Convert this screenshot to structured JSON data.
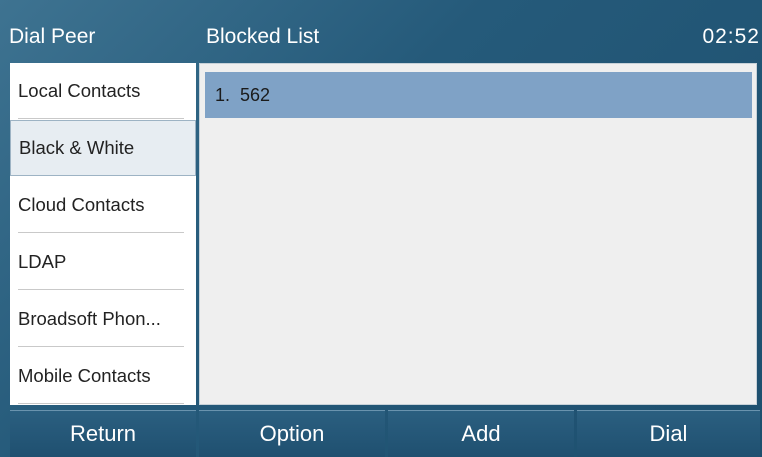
{
  "header": {
    "left_title": "Dial Peer",
    "center_title": "Blocked List",
    "clock": "02:52"
  },
  "sidebar": {
    "items": [
      {
        "label": "Local Contacts",
        "selected": false
      },
      {
        "label": "Black & White",
        "selected": true
      },
      {
        "label": "Cloud Contacts",
        "selected": false
      },
      {
        "label": "LDAP",
        "selected": false
      },
      {
        "label": "Broadsoft Phon...",
        "selected": false
      },
      {
        "label": "Mobile Contacts",
        "selected": false
      }
    ]
  },
  "main": {
    "rows": [
      {
        "index": "1.",
        "number": "562"
      }
    ]
  },
  "softkeys": {
    "k1": "Return",
    "k2": "Option",
    "k3": "Add",
    "k4": "Dial"
  },
  "colors": {
    "header_bg": "#2f6686",
    "selected_row": "#7fa2c6",
    "panel_bg": "#efefef",
    "softkey_bg": "#23567a"
  }
}
